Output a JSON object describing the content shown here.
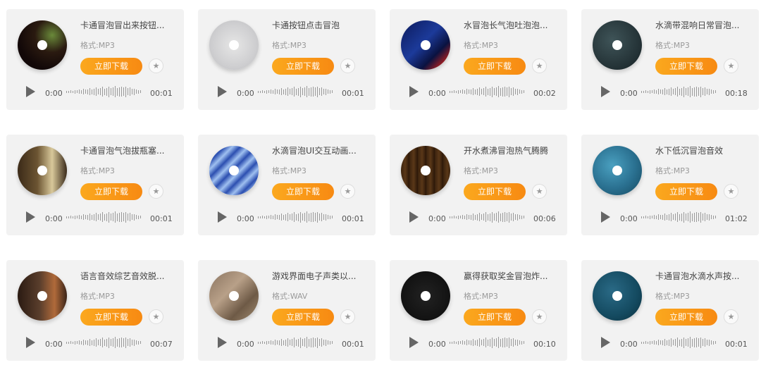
{
  "colors": {
    "accent": "#f78a12",
    "card_bg": "#f2f2f2"
  },
  "download_label": "立即下载",
  "fav_icon": "star-icon",
  "play_icon": "play-icon",
  "cards": [
    {
      "title": "卡通冒泡冒出来按钮...",
      "format": "格式:MP3",
      "current": "0:00",
      "duration": "00:01"
    },
    {
      "title": "卡通按钮点击冒泡",
      "format": "格式:MP3",
      "current": "0:00",
      "duration": "00:01"
    },
    {
      "title": "水冒泡长气泡吐泡泡...",
      "format": "格式:MP3",
      "current": "0:00",
      "duration": "00:02"
    },
    {
      "title": "水滴带混响日常冒泡...",
      "format": "格式:MP3",
      "current": "0:00",
      "duration": "00:18"
    },
    {
      "title": "卡通冒泡气泡拔瓶塞...",
      "format": "格式:MP3",
      "current": "0:00",
      "duration": "00:01"
    },
    {
      "title": "水滴冒泡UI交互动画...",
      "format": "格式:MP3",
      "current": "0:00",
      "duration": "00:01"
    },
    {
      "title": "开水煮沸冒泡热气腾腾",
      "format": "格式:MP3",
      "current": "0:00",
      "duration": "00:06"
    },
    {
      "title": "水下低沉冒泡音效",
      "format": "格式:MP3",
      "current": "0:00",
      "duration": "01:02"
    },
    {
      "title": "语言音效综艺音效脱...",
      "format": "格式:MP3",
      "current": "0:00",
      "duration": "00:07"
    },
    {
      "title": "游戏界面电子声类以...",
      "format": "格式:WAV",
      "current": "0:00",
      "duration": "00:01"
    },
    {
      "title": "赢得获取奖金冒泡炸...",
      "format": "格式:MP3",
      "current": "0:00",
      "duration": "00:10"
    },
    {
      "title": "卡通冒泡水滴水声按...",
      "format": "格式:MP3",
      "current": "0:00",
      "duration": "00:01"
    }
  ]
}
